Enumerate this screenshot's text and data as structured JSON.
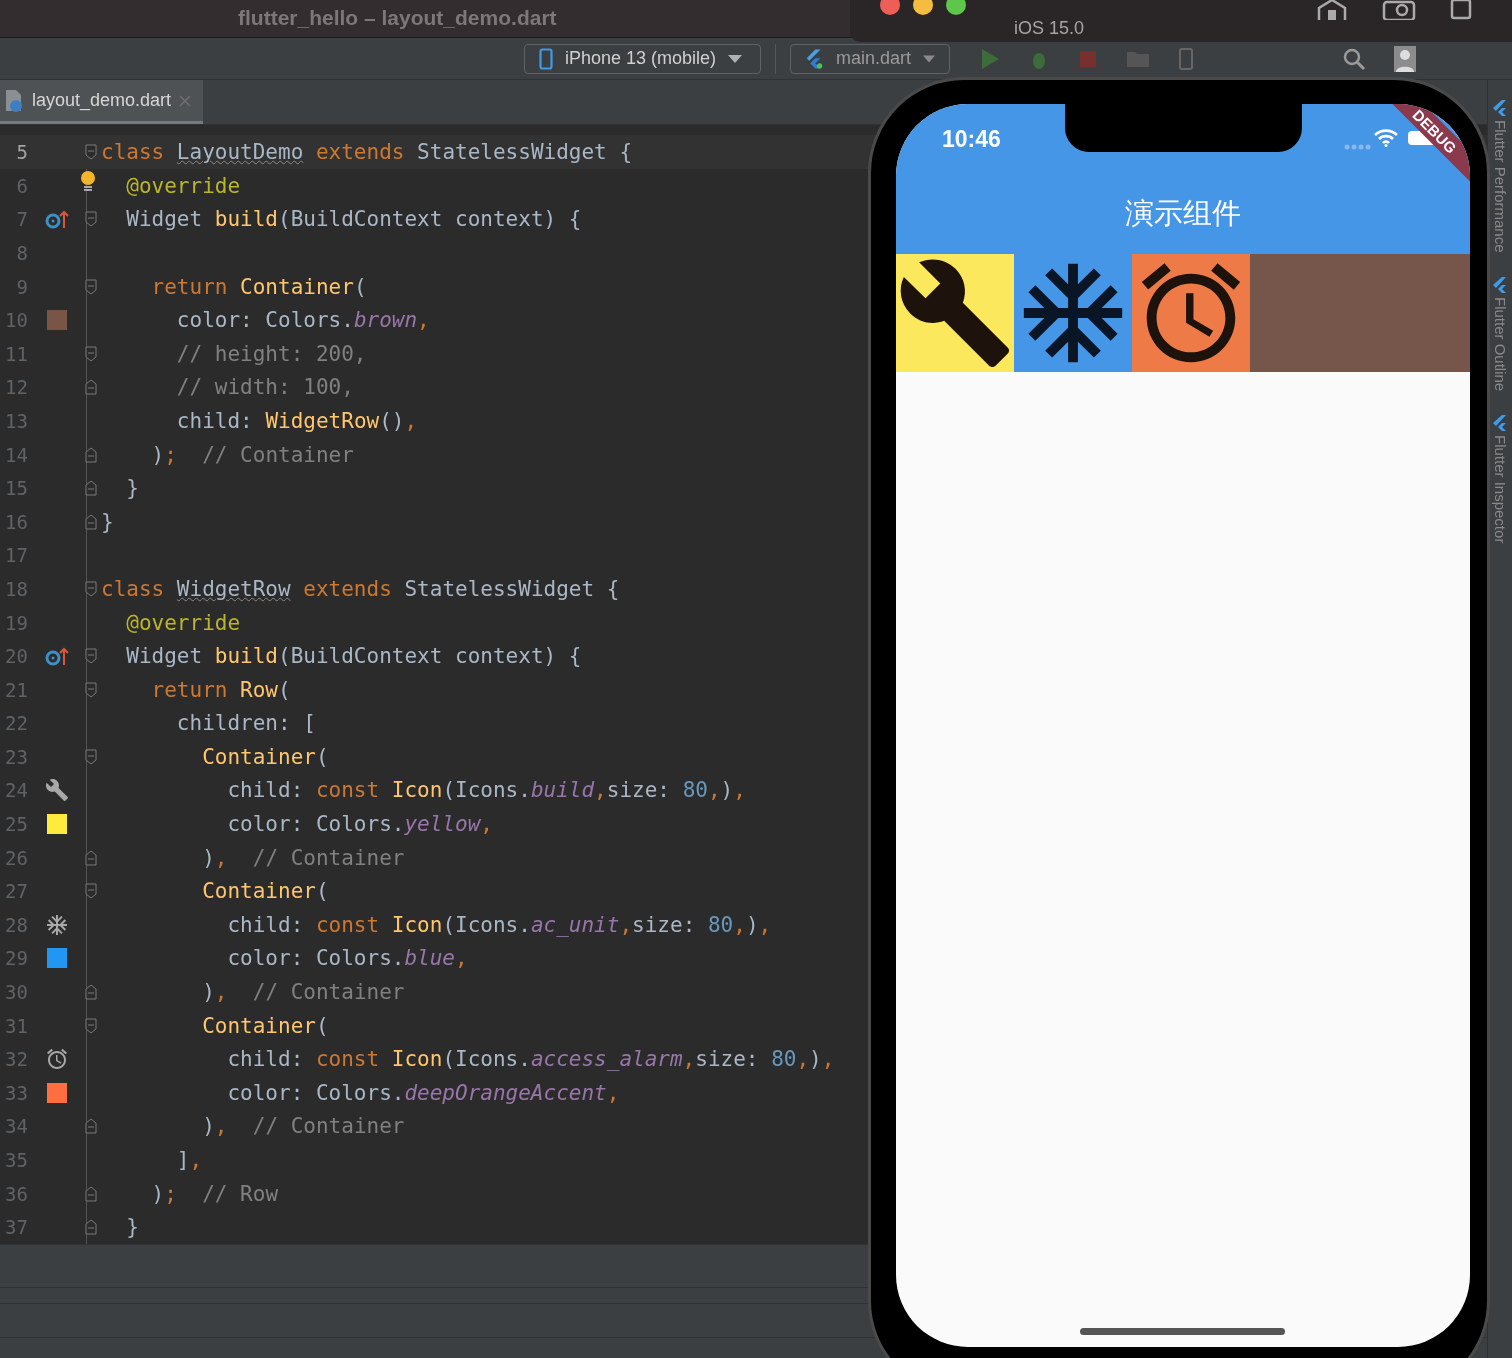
{
  "ide": {
    "title": "flutter_hello – layout_demo.dart",
    "toolbar": {
      "device": "iPhone 13 (mobile)",
      "run_config": "main.dart"
    },
    "tabs": [
      {
        "label": "layout_demo.dart",
        "selected": true
      }
    ],
    "editor": {
      "lines": [
        {
          "n": "5",
          "current": true,
          "fold": {
            "kind": "open"
          },
          "segs": [
            {
              "text": "class ",
              "kind": "kw"
            },
            {
              "text": "LayoutDemo",
              "kind": "decl"
            },
            {
              "text": " extends ",
              "kind": "kw"
            },
            {
              "text": "StatelessWidget {",
              "kind": "plain"
            }
          ]
        },
        {
          "n": "6",
          "current": false,
          "bulb": true,
          "segs": [
            {
              "text": "  @override",
              "kind": "annot"
            }
          ]
        },
        {
          "n": "7",
          "current": false,
          "fold": {
            "kind": "open"
          },
          "gutter": {
            "kind": "override"
          },
          "segs": [
            {
              "text": "  Widget ",
              "kind": "plain"
            },
            {
              "text": "build",
              "kind": "fn"
            },
            {
              "text": "(BuildContext context) {",
              "kind": "plain"
            }
          ]
        },
        {
          "n": "8",
          "current": false
        },
        {
          "n": "9",
          "current": false,
          "fold": {
            "kind": "open"
          },
          "segs": [
            {
              "text": "    return ",
              "kind": "kw"
            },
            {
              "text": "Container",
              "kind": "fn"
            },
            {
              "text": "(",
              "kind": "plain"
            }
          ]
        },
        {
          "n": "10",
          "current": false,
          "gutter": {
            "kind": "swatch",
            "color": "#795548"
          },
          "segs": [
            {
              "text": "      color: Colors.",
              "kind": "plain"
            },
            {
              "text": "brown",
              "kind": "field"
            },
            {
              "text": ",",
              "kind": "kw"
            }
          ]
        },
        {
          "n": "11",
          "current": false,
          "fold": {
            "kind": "open"
          },
          "segs": [
            {
              "text": "      // height: 200,",
              "kind": "comment"
            }
          ]
        },
        {
          "n": "12",
          "current": false,
          "fold": {
            "kind": "close"
          },
          "segs": [
            {
              "text": "      // width: 100,",
              "kind": "comment"
            }
          ]
        },
        {
          "n": "13",
          "current": false,
          "segs": [
            {
              "text": "      child: ",
              "kind": "plain"
            },
            {
              "text": "WidgetRow",
              "kind": "fn"
            },
            {
              "text": "()",
              "kind": "plain"
            },
            {
              "text": ",",
              "kind": "kw"
            }
          ]
        },
        {
          "n": "14",
          "current": false,
          "fold": {
            "kind": "close"
          },
          "segs": [
            {
              "text": "    )",
              "kind": "plain"
            },
            {
              "text": ";",
              "kind": "kw"
            },
            {
              "text": "  // Container",
              "kind": "comment"
            }
          ]
        },
        {
          "n": "15",
          "current": false,
          "fold": {
            "kind": "close"
          },
          "segs": [
            {
              "text": "  }",
              "kind": "plain"
            }
          ]
        },
        {
          "n": "16",
          "current": false,
          "fold": {
            "kind": "close"
          },
          "segs": [
            {
              "text": "}",
              "kind": "plain"
            }
          ]
        },
        {
          "n": "17",
          "current": false
        },
        {
          "n": "18",
          "current": false,
          "fold": {
            "kind": "open"
          },
          "segs": [
            {
              "text": "class ",
              "kind": "kw"
            },
            {
              "text": "WidgetRow",
              "kind": "decl"
            },
            {
              "text": " extends ",
              "kind": "kw"
            },
            {
              "text": "StatelessWidget {",
              "kind": "plain"
            }
          ]
        },
        {
          "n": "19",
          "current": false,
          "segs": [
            {
              "text": "  @override",
              "kind": "annot"
            }
          ]
        },
        {
          "n": "20",
          "current": false,
          "fold": {
            "kind": "open"
          },
          "gutter": {
            "kind": "override"
          },
          "segs": [
            {
              "text": "  Widget ",
              "kind": "plain"
            },
            {
              "text": "build",
              "kind": "fn"
            },
            {
              "text": "(BuildContext context) {",
              "kind": "plain"
            }
          ]
        },
        {
          "n": "21",
          "current": false,
          "fold": {
            "kind": "open"
          },
          "segs": [
            {
              "text": "    return ",
              "kind": "kw"
            },
            {
              "text": "Row",
              "kind": "fn"
            },
            {
              "text": "(",
              "kind": "plain"
            }
          ]
        },
        {
          "n": "22",
          "current": false,
          "segs": [
            {
              "text": "      children: [",
              "kind": "plain"
            }
          ]
        },
        {
          "n": "23",
          "current": false,
          "fold": {
            "kind": "open"
          },
          "segs": [
            {
              "text": "        Container",
              "kind": "fn"
            },
            {
              "text": "(",
              "kind": "plain"
            }
          ]
        },
        {
          "n": "24",
          "current": false,
          "gutter": {
            "kind": "wrench"
          },
          "segs": [
            {
              "text": "          child: ",
              "kind": "plain"
            },
            {
              "text": "const ",
              "kind": "kw"
            },
            {
              "text": "Icon",
              "kind": "fn"
            },
            {
              "text": "(Icons.",
              "kind": "plain"
            },
            {
              "text": "build",
              "kind": "field"
            },
            {
              "text": ",",
              "kind": "kw"
            },
            {
              "text": "size: ",
              "kind": "plain"
            },
            {
              "text": "80",
              "kind": "num"
            },
            {
              "text": ",",
              "kind": "kw"
            },
            {
              "text": ")",
              "kind": "plain"
            },
            {
              "text": ",",
              "kind": "kw"
            }
          ]
        },
        {
          "n": "25",
          "current": false,
          "gutter": {
            "kind": "swatch",
            "color": "#ffeb3b"
          },
          "segs": [
            {
              "text": "          color: Colors.",
              "kind": "plain"
            },
            {
              "text": "yellow",
              "kind": "field"
            },
            {
              "text": ",",
              "kind": "kw"
            }
          ]
        },
        {
          "n": "26",
          "current": false,
          "fold": {
            "kind": "close"
          },
          "segs": [
            {
              "text": "        )",
              "kind": "plain"
            },
            {
              "text": ",",
              "kind": "kw"
            },
            {
              "text": "  // Container",
              "kind": "comment"
            }
          ]
        },
        {
          "n": "27",
          "current": false,
          "fold": {
            "kind": "open"
          },
          "segs": [
            {
              "text": "        Container",
              "kind": "fn"
            },
            {
              "text": "(",
              "kind": "plain"
            }
          ]
        },
        {
          "n": "28",
          "current": false,
          "gutter": {
            "kind": "snowflake"
          },
          "segs": [
            {
              "text": "          child: ",
              "kind": "plain"
            },
            {
              "text": "const ",
              "kind": "kw"
            },
            {
              "text": "Icon",
              "kind": "fn"
            },
            {
              "text": "(Icons.",
              "kind": "plain"
            },
            {
              "text": "ac_unit",
              "kind": "field"
            },
            {
              "text": ",",
              "kind": "kw"
            },
            {
              "text": "size: ",
              "kind": "plain"
            },
            {
              "text": "80",
              "kind": "num"
            },
            {
              "text": ",",
              "kind": "kw"
            },
            {
              "text": ")",
              "kind": "plain"
            },
            {
              "text": ",",
              "kind": "kw"
            }
          ]
        },
        {
          "n": "29",
          "current": false,
          "gutter": {
            "kind": "swatch",
            "color": "#2196f3"
          },
          "segs": [
            {
              "text": "          color: Colors.",
              "kind": "plain"
            },
            {
              "text": "blue",
              "kind": "field"
            },
            {
              "text": ",",
              "kind": "kw"
            }
          ]
        },
        {
          "n": "30",
          "current": false,
          "fold": {
            "kind": "close"
          },
          "segs": [
            {
              "text": "        )",
              "kind": "plain"
            },
            {
              "text": ",",
              "kind": "kw"
            },
            {
              "text": "  // Container",
              "kind": "comment"
            }
          ]
        },
        {
          "n": "31",
          "current": false,
          "fold": {
            "kind": "open"
          },
          "segs": [
            {
              "text": "        Container",
              "kind": "fn"
            },
            {
              "text": "(",
              "kind": "plain"
            }
          ]
        },
        {
          "n": "32",
          "current": false,
          "gutter": {
            "kind": "alarm"
          },
          "segs": [
            {
              "text": "          child: ",
              "kind": "plain"
            },
            {
              "text": "const ",
              "kind": "kw"
            },
            {
              "text": "Icon",
              "kind": "fn"
            },
            {
              "text": "(Icons.",
              "kind": "plain"
            },
            {
              "text": "access_alarm",
              "kind": "field"
            },
            {
              "text": ",",
              "kind": "kw"
            },
            {
              "text": "size: ",
              "kind": "plain"
            },
            {
              "text": "80",
              "kind": "num"
            },
            {
              "text": ",",
              "kind": "kw"
            },
            {
              "text": ")",
              "kind": "plain"
            },
            {
              "text": ",",
              "kind": "kw"
            }
          ]
        },
        {
          "n": "33",
          "current": false,
          "gutter": {
            "kind": "swatch",
            "color": "#ff6e40"
          },
          "segs": [
            {
              "text": "          color: Colors.",
              "kind": "plain"
            },
            {
              "text": "deepOrangeAccent",
              "kind": "field"
            },
            {
              "text": ",",
              "kind": "kw"
            }
          ]
        },
        {
          "n": "34",
          "current": false,
          "fold": {
            "kind": "close"
          },
          "segs": [
            {
              "text": "        )",
              "kind": "plain"
            },
            {
              "text": ",",
              "kind": "kw"
            },
            {
              "text": "  // Container",
              "kind": "comment"
            }
          ]
        },
        {
          "n": "35",
          "current": false,
          "segs": [
            {
              "text": "      ]",
              "kind": "plain"
            },
            {
              "text": ",",
              "kind": "kw"
            }
          ]
        },
        {
          "n": "36",
          "current": false,
          "fold": {
            "kind": "close"
          },
          "segs": [
            {
              "text": "    )",
              "kind": "plain"
            },
            {
              "text": ";",
              "kind": "kw"
            },
            {
              "text": "  // Row",
              "kind": "comment"
            }
          ]
        },
        {
          "n": "37",
          "current": false,
          "fold": {
            "kind": "close"
          },
          "segs": [
            {
              "text": "  }",
              "kind": "plain"
            }
          ]
        }
      ]
    },
    "side_tools": [
      "Flutter Performance",
      "Flutter Outline",
      "Flutter Inspector"
    ]
  },
  "simulator": {
    "subtitle": "iOS 15.0",
    "time": "10:46",
    "banner": "DEBUG",
    "app_bar_title": "演示组件",
    "row": [
      {
        "kind": "wrench",
        "color": "#fce85c"
      },
      {
        "kind": "snowflake",
        "color": "#4696e8"
      },
      {
        "kind": "alarm",
        "color": "#ee7a48"
      }
    ]
  }
}
